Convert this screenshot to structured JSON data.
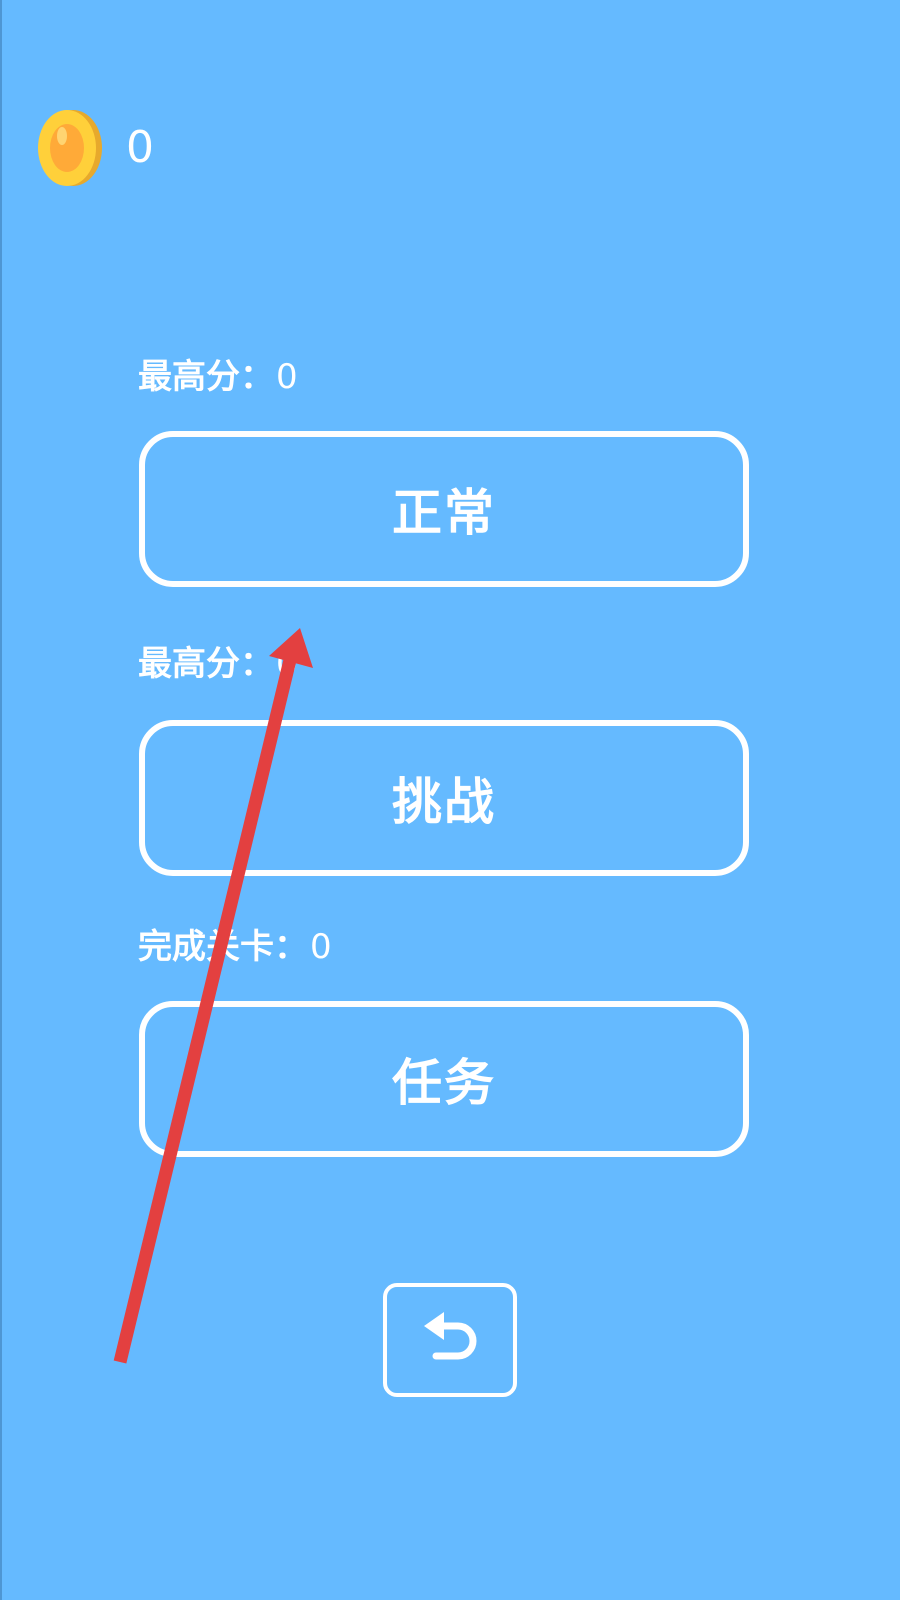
{
  "colors": {
    "background": "#65baff",
    "text": "#ffffff",
    "coin_outer": "#ffd03a",
    "coin_inner": "#ffaa38",
    "annotation": "#e34040"
  },
  "coins": {
    "icon": "coin-icon",
    "count": "0"
  },
  "modes": [
    {
      "stat_label": "最高分：",
      "stat_value": "0",
      "button_label": "正常"
    },
    {
      "stat_label": "最高分：",
      "stat_value": "0",
      "button_label": "挑战"
    },
    {
      "stat_label": "完成关卡：",
      "stat_value": "0",
      "button_label": "任务"
    }
  ],
  "back_button": {
    "icon": "undo-arrow-icon"
  }
}
